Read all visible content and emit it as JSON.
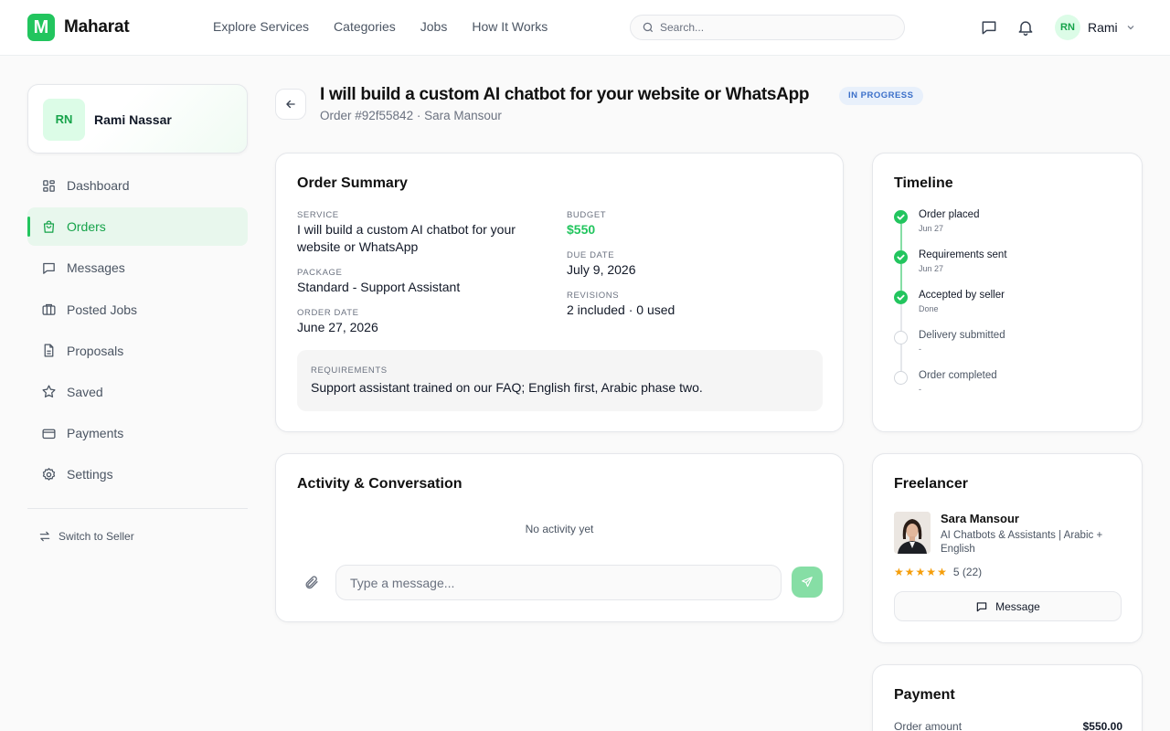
{
  "header": {
    "logo_letter": "M",
    "brand": "Maharat",
    "nav": [
      "Explore Services",
      "Categories",
      "Jobs",
      "How It Works"
    ],
    "search_placeholder": "Search...",
    "user_initials": "RN",
    "user_name": "Rami"
  },
  "sidebar": {
    "profile_initials": "RN",
    "profile_name": "Rami Nassar",
    "items": [
      {
        "label": "Dashboard",
        "icon": "dashboard-icon"
      },
      {
        "label": "Orders",
        "icon": "orders-bag-icon",
        "active": true
      },
      {
        "label": "Messages",
        "icon": "message-icon"
      },
      {
        "label": "Posted Jobs",
        "icon": "briefcase-icon"
      },
      {
        "label": "Proposals",
        "icon": "document-icon"
      },
      {
        "label": "Saved",
        "icon": "star-icon"
      },
      {
        "label": "Payments",
        "icon": "credit-card-icon"
      },
      {
        "label": "Settings",
        "icon": "gear-icon"
      }
    ],
    "switch_label": "Switch to Seller"
  },
  "order": {
    "title": "I will build a custom AI chatbot for your website or WhatsApp",
    "status": "IN PROGRESS",
    "subtitle": "Order #92f55842 · Sara Mansour"
  },
  "summary": {
    "title": "Order Summary",
    "service_label": "SERVICE",
    "service_value": "I will build a custom AI chatbot for your website or WhatsApp",
    "package_label": "PACKAGE",
    "package_value": "Standard - Support Assistant",
    "order_date_label": "ORDER DATE",
    "order_date_value": "June 27, 2026",
    "budget_label": "BUDGET",
    "budget_value": "$550",
    "due_date_label": "DUE DATE",
    "due_date_value": "July 9, 2026",
    "revisions_label": "REVISIONS",
    "revisions_value": "2 included · 0 used",
    "requirements_label": "REQUIREMENTS",
    "requirements_value": "Support assistant trained on our FAQ; English first, Arabic phase two."
  },
  "activity": {
    "title": "Activity & Conversation",
    "empty": "No activity yet",
    "input_placeholder": "Type a message..."
  },
  "timeline": {
    "title": "Timeline",
    "steps": [
      {
        "name": "Order placed",
        "date": "Jun 27",
        "done": true
      },
      {
        "name": "Requirements sent",
        "date": "Jun 27",
        "done": true
      },
      {
        "name": "Accepted by seller",
        "date": "Done",
        "done": true
      },
      {
        "name": "Delivery submitted",
        "date": "-",
        "done": false
      },
      {
        "name": "Order completed",
        "date": "-",
        "done": false
      }
    ]
  },
  "freelancer": {
    "title": "Freelancer",
    "name": "Sara Mansour",
    "role": "AI Chatbots & Assistants | Arabic + English",
    "rating": 5,
    "rating_text": "5 (22)",
    "message_label": "Message"
  },
  "payment": {
    "title": "Payment",
    "order_amount_label": "Order amount",
    "order_amount_value": "$550.00"
  },
  "colors": {
    "accent": "#22c55e",
    "badge_bg": "#e8f0fb",
    "badge_text": "#3b6fc9"
  }
}
